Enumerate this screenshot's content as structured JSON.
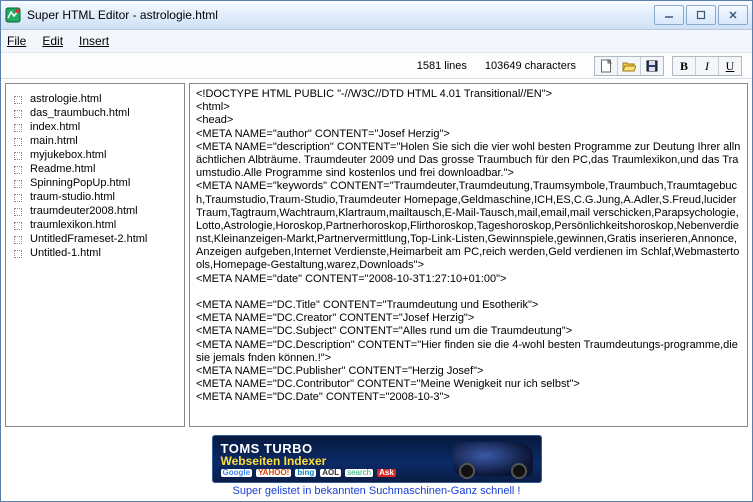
{
  "window": {
    "title": "Super HTML Editor - astrologie.html"
  },
  "menu": {
    "file": "File",
    "edit": "Edit",
    "insert": "Insert"
  },
  "stats": {
    "lines": "1581 lines",
    "chars": "103649 characters"
  },
  "format": {
    "bold": "B",
    "italic": "I",
    "underline": "U"
  },
  "files": [
    "astrologie.html",
    "das_traumbuch.html",
    "index.html",
    "main.html",
    "myjukebox.html",
    "Readme.html",
    "SpinningPopUp.html",
    "traum-studio.html",
    "traumdeuter2008.html",
    "traumlexikon.html",
    "UntitledFrameset-2.html",
    "Untitled-1.html"
  ],
  "editor_content": "<!DOCTYPE HTML PUBLIC \"-//W3C//DTD HTML 4.01 Transitional//EN\">\n<html>\n<head>\n<META NAME=\"author\" CONTENT=\"Josef Herzig\">\n<META NAME=\"description\" CONTENT=\"Holen Sie sich die vier wohl besten Programme zur Deutung Ihrer allnächtlichen Albträume. Traumdeuter 2009 und Das grosse Traumbuch für den PC,das Traumlexikon,und das Traumstudio.Alle Programme sind kostenlos und frei downloadbar.\">\n<META NAME=\"keywords\" CONTENT=\"Traumdeuter,Traumdeutung,Traumsymbole,Traumbuch,Traumtagebuch,Traumstudio,Traum-Studio,Traumdeuter Homepage,Geldmaschine,ICH,ES,C.G.Jung,A.Adler,S.Freud,lucider Traum,Tagtraum,Wachtraum,Klartraum,mailtausch,E-Mail-Tausch,mail,email,mail verschicken,Parapsychologie,Lotto,Astrologie,Horoskop,Partnerhoroskop,Flirthoroskop,Tageshoroskop,Persönlichkeitshoroskop,Nebenverdienst,Kleinanzeigen-Markt,Partnervermittlung,Top-Link-Listen,Gewinnspiele,gewinnen,Gratis inserieren,Annonce,Anzeigen aufgeben,Internet Verdienste,Heimarbeit am PC,reich werden,Geld verdienen im Schlaf,Webmastertools,Homepage-Gestaltung,warez,Downloads\">\n<META NAME=\"date\" CONTENT=\"2008-10-3T1:27:10+01:00\">\n\n<META NAME=\"DC.Title\" CONTENT=\"Traumdeutung und Esotherik\">\n<META NAME=\"DC.Creator\" CONTENT=\"Josef Herzig\">\n<META NAME=\"DC.Subject\" CONTENT=\"Alles rund um die Traumdeutung\">\n<META NAME=\"DC.Description\" CONTENT=\"Hier finden sie die 4-wohl besten Traumdeutungs-programme,die sie jemals fnden können.!\">\n<META NAME=\"DC.Publisher\" CONTENT=\"Herzig Josef\">\n<META NAME=\"DC.Contributor\" CONTENT=\"Meine Wenigkeit nur ich selbst\">\n<META NAME=\"DC.Date\" CONTENT=\"2008-10-3\">",
  "banner": {
    "title": "TOMS TURBO",
    "subtitle": "Webseiten Indexer",
    "engines": [
      "Google",
      "YAHOO!",
      "bing",
      "AOL",
      "search",
      "Ask"
    ],
    "caption": "Super gelistet in bekannten Suchmaschinen-Ganz schnell !"
  }
}
